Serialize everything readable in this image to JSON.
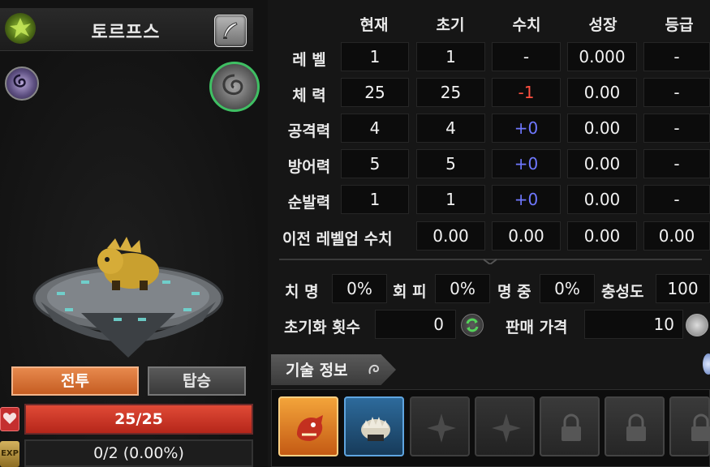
{
  "monster": {
    "name": "토르프스"
  },
  "buttons": {
    "battle": "전투",
    "ride": "탑승"
  },
  "hp": {
    "text": "25/25",
    "fraction": 1.0
  },
  "exp": {
    "icon_label": "EXP",
    "text": "0/2 (0.00%)",
    "fraction": 0.0
  },
  "stats": {
    "columns": [
      "현재",
      "초기",
      "수치",
      "성장",
      "등급"
    ],
    "rows": [
      {
        "label": "레 벨",
        "current": "1",
        "initial": "1",
        "value": "-",
        "growth": "0.000",
        "grade": "-"
      },
      {
        "label": "체 력",
        "current": "25",
        "initial": "25",
        "value": "-1",
        "growth": "0.00",
        "grade": "-"
      },
      {
        "label": "공격력",
        "current": "4",
        "initial": "4",
        "value": "+0",
        "growth": "0.00",
        "grade": "-"
      },
      {
        "label": "방어력",
        "current": "5",
        "initial": "5",
        "value": "+0",
        "growth": "0.00",
        "grade": "-"
      },
      {
        "label": "순발력",
        "current": "1",
        "initial": "1",
        "value": "+0",
        "growth": "0.00",
        "grade": "-"
      }
    ],
    "prev_levelup": {
      "label": "이전 레벨업 수치",
      "values": [
        "0.00",
        "0.00",
        "0.00",
        "0.00"
      ]
    }
  },
  "secondary": {
    "crit_label": "치 명",
    "crit_value": "0%",
    "evade_label": "회 피",
    "evade_value": "0%",
    "accuracy_label": "명 중",
    "accuracy_value": "0%",
    "loyalty_label": "충성도",
    "loyalty_value": "100"
  },
  "reset": {
    "label": "초기화 횟수",
    "value": "0"
  },
  "sell": {
    "label": "판매 가격",
    "value": "10"
  },
  "skills": {
    "tab_label": "기술 정보",
    "slots": [
      {
        "state": "skill",
        "icon": "red-dragon-skill-icon"
      },
      {
        "state": "skill",
        "icon": "spiked-shell-skill-icon"
      },
      {
        "state": "empty",
        "icon": "empty-slot-icon"
      },
      {
        "state": "empty",
        "icon": "empty-slot-icon"
      },
      {
        "state": "locked",
        "icon": "lock-icon"
      },
      {
        "state": "locked",
        "icon": "lock-icon"
      },
      {
        "state": "locked",
        "icon": "lock-icon"
      }
    ]
  },
  "colors": {
    "negative": "#ff5040",
    "positive": "#6f78ff",
    "battle_button": "#e07a3c",
    "hp_bar": "#d93a2a",
    "rune_green": "#3fbf63"
  }
}
